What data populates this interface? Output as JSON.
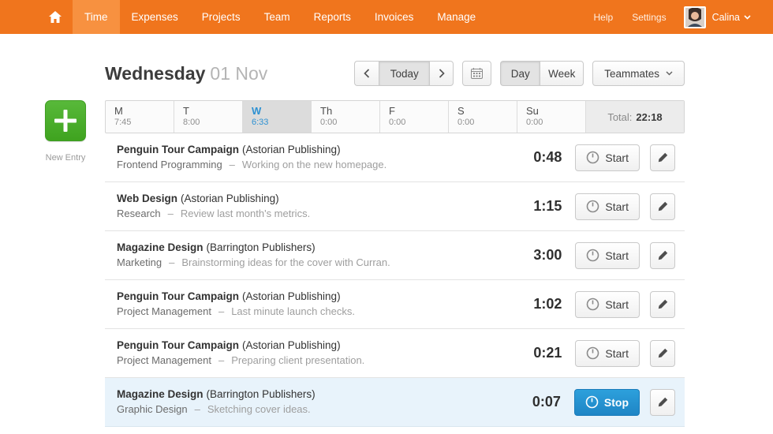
{
  "ui": {
    "dash": "–"
  },
  "colors": {
    "nav_orange": "#f0751d",
    "nav_active_orange": "#f79140",
    "new_entry_green": "#4aac2c",
    "stop_blue": "#1f87c6",
    "active_day_blue": "#2e91d2",
    "running_row_bg": "#e8f3fb"
  },
  "nav": {
    "items": [
      {
        "label": "Time"
      },
      {
        "label": "Expenses"
      },
      {
        "label": "Projects"
      },
      {
        "label": "Team"
      },
      {
        "label": "Reports"
      },
      {
        "label": "Invoices"
      },
      {
        "label": "Manage"
      }
    ],
    "help": "Help",
    "settings": "Settings",
    "user": "Calina"
  },
  "header": {
    "day_name": "Wednesday",
    "date": "01 Nov",
    "today_label": "Today",
    "day_label": "Day",
    "week_label": "Week",
    "teammates_label": "Teammates"
  },
  "week": {
    "days": [
      {
        "label": "M",
        "time": "7:45"
      },
      {
        "label": "T",
        "time": "8:00"
      },
      {
        "label": "W",
        "time": "6:33"
      },
      {
        "label": "Th",
        "time": "0:00"
      },
      {
        "label": "F",
        "time": "0:00"
      },
      {
        "label": "S",
        "time": "0:00"
      },
      {
        "label": "Su",
        "time": "0:00"
      }
    ],
    "active_day": "W",
    "total_label": "Total:",
    "total_value": "22:18"
  },
  "new_entry": {
    "label": "New Entry"
  },
  "entries": [
    {
      "project": "Penguin Tour Campaign",
      "client": "(Astorian Publishing)",
      "task": "Frontend Programming",
      "notes": "Working on the new homepage.",
      "time": "0:48",
      "action": "Start"
    },
    {
      "project": "Web Design",
      "client": "(Astorian Publishing)",
      "task": "Research",
      "notes": "Review last month's metrics.",
      "time": "1:15",
      "action": "Start"
    },
    {
      "project": "Magazine Design",
      "client": "(Barrington Publishers)",
      "task": "Marketing",
      "notes": "Brainstorming ideas for the cover with Curran.",
      "time": "3:00",
      "action": "Start"
    },
    {
      "project": "Penguin Tour Campaign",
      "client": "(Astorian Publishing)",
      "task": "Project Management",
      "notes": "Last minute launch checks.",
      "time": "1:02",
      "action": "Start"
    },
    {
      "project": "Penguin Tour Campaign",
      "client": "(Astorian Publishing)",
      "task": "Project Management",
      "notes": "Preparing client presentation.",
      "time": "0:21",
      "action": "Start"
    },
    {
      "project": "Magazine Design",
      "client": "(Barrington Publishers)",
      "task": "Graphic Design",
      "notes": "Sketching cover ideas.",
      "time": "0:07",
      "action": "Stop",
      "running": true
    }
  ]
}
